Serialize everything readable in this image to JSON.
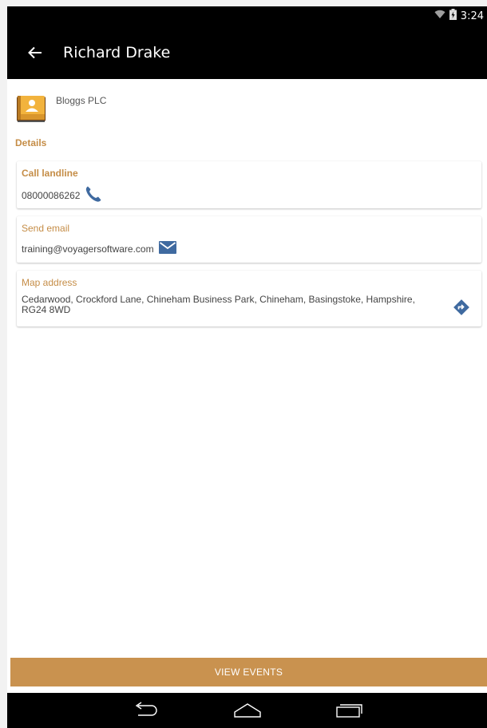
{
  "status_bar": {
    "time": "3:24",
    "icons": [
      "wifi-icon",
      "battery-icon"
    ]
  },
  "app_bar": {
    "title": "Richard Drake",
    "back_icon": "arrow-left-icon"
  },
  "company": {
    "name": "Bloggs PLC",
    "logo_icon": "contact-book-icon"
  },
  "details": {
    "section_label": "Details",
    "phone": {
      "title": "Call landline",
      "value": "08000086262",
      "icon": "phone-icon"
    },
    "email": {
      "title": "Send email",
      "value": "training@voyagersoftware.com",
      "icon": "email-icon"
    },
    "map": {
      "title": "Map address",
      "value": "Cedarwood, Crockford Lane, Chineham Business Park, Chineham, Basingstoke, Hampshire, RG24 8WD",
      "icon": "directions-icon"
    }
  },
  "actions": {
    "view_events": "VIEW EVENTS"
  },
  "nav_bar": {
    "icons": [
      "back-nav-icon",
      "home-nav-icon",
      "recents-nav-icon"
    ]
  },
  "colors": {
    "accent": "#c58d47",
    "button": "#c9924f",
    "icon_blue": "#3f6aa0",
    "bar": "#000000"
  }
}
